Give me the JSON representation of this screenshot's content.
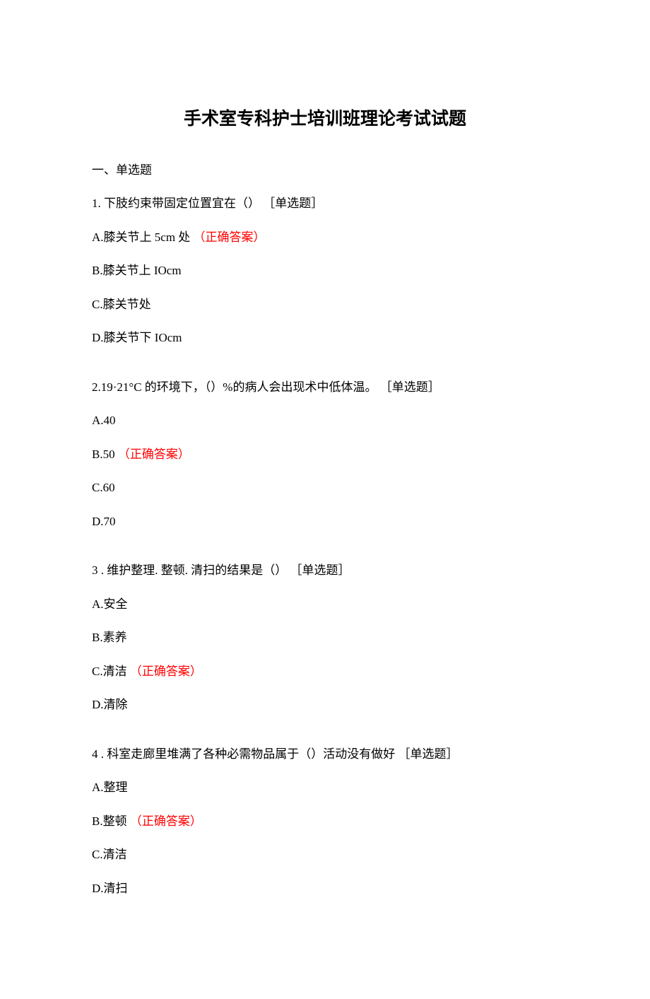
{
  "title": "手术室专科护士培训班理论考试试题",
  "sectionHeading": "一、单选题",
  "tag": "［单选题］",
  "answerTag": "（正确答案）",
  "questions": [
    {
      "stem": "1. 下肢约束带固定位置宜在（）",
      "options": [
        {
          "pre": "A.膝关节上 5cm 处",
          "correct": true
        },
        {
          "pre": "B.膝关节上 IOcm",
          "correct": false
        },
        {
          "pre": "C.膝关节处",
          "correct": false
        },
        {
          "pre": "D.膝关节下 IOcm",
          "correct": false
        }
      ]
    },
    {
      "stem": "2.19·21°C 的环境下，（）%的病人会出现术中低体温。",
      "options": [
        {
          "pre": "A.40",
          "correct": false
        },
        {
          "pre": "B.50",
          "correct": true
        },
        {
          "pre": "C.60",
          "correct": false
        },
        {
          "pre": "D.70",
          "correct": false
        }
      ]
    },
    {
      "stem": "3  . 维护整理. 整顿. 清扫的结果是（）",
      "options": [
        {
          "pre": "A.安全",
          "correct": false
        },
        {
          "pre": "B.素养",
          "correct": false
        },
        {
          "pre": "C.清洁",
          "correct": true
        },
        {
          "pre": "D.清除",
          "correct": false
        }
      ]
    },
    {
      "stem": "4  . 科室走廊里堆满了各种必需物品属于（）活动没有做好",
      "options": [
        {
          "pre": "A.整理",
          "correct": false
        },
        {
          "pre": "B.整顿",
          "correct": true
        },
        {
          "pre": "C.清洁",
          "correct": false
        },
        {
          "pre": "D.清扫",
          "correct": false
        }
      ]
    }
  ]
}
